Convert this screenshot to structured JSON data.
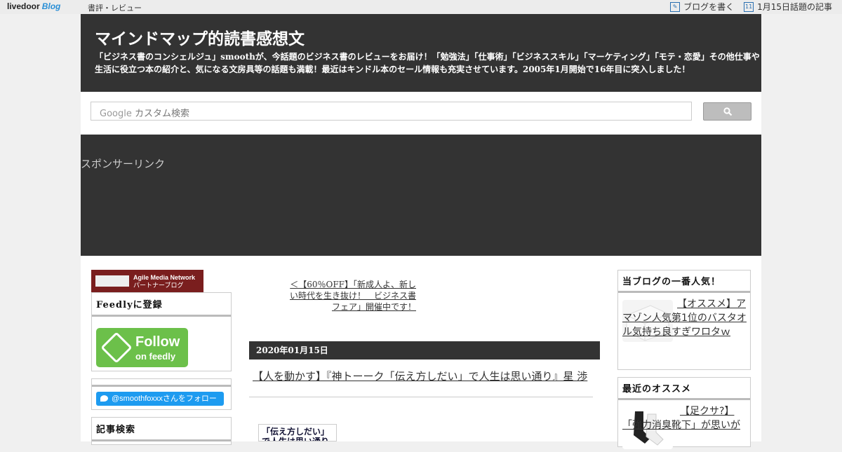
{
  "topbar": {
    "logo": "livedoor",
    "logo_blog": "Blog",
    "category": "書評・レビュー",
    "write_blog": "ブログを書く",
    "calendar_day": "11",
    "topic_link": "1月15日話題の記事"
  },
  "header": {
    "title": "マインドマップ的読書感想文",
    "description": "「ビジネス書のコンシェルジュ」smoothが、今話題のビジネス書のレビューをお届け！「勉強法」「仕事術」「ビジネススキル」「マーケティング」「モテ・恋愛」その他仕事や生活に役立つ本の紹介と、気になる文房具等の話題も満載！最近はキンドル本のセール情報も充実させています。2005年1月開始で16年目に突入しました！"
  },
  "search": {
    "placeholder_brand": "Google",
    "placeholder": "カスタム検索"
  },
  "sponsor": {
    "label": "スポンサーリンク"
  },
  "left_sidebar": {
    "amn_title": "Agile Media Network",
    "amn_sub": "パートナーブログ",
    "feedly_heading": "Feedlyに登録",
    "feedly_btn_line1": "Follow",
    "feedly_btn_line2": "on feedly",
    "twitter_follow": "@smoothfoxxxさんをフォロー",
    "search_heading": "記事検索"
  },
  "main": {
    "prev_link": "＜【60％OFF】「新成人よ、新しい時代を生き抜け！　ビジネス書フェア」開催中です！",
    "date": "2020年01月15日",
    "article_title": "【人を動かす】『神トーーク「伝え方しだい」で人生は思い通り』星 渉",
    "book_thumb_text": "「伝え方しだい」で人生は思い通り"
  },
  "right_sidebar": {
    "popular_heading": "当ブログの一番人気！",
    "popular_item": "【オススメ】アマゾン人気第1位のバスタオル気持ち良すぎワロタｗ",
    "recent_heading": "最近のオススメ",
    "recent_item": "【足クサ?】「強力消臭靴下」が思いが"
  }
}
